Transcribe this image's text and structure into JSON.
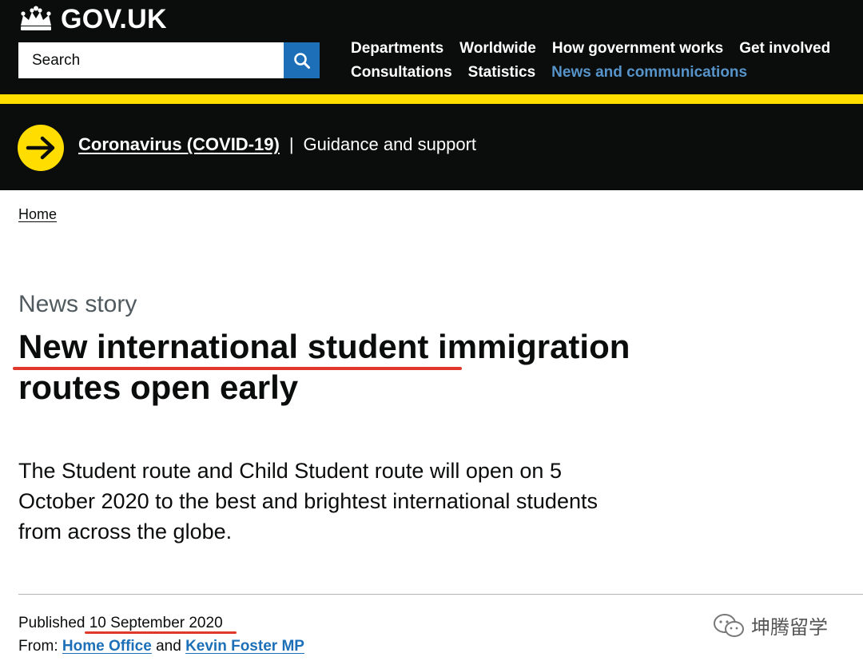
{
  "header": {
    "logo_text": "GOV.UK",
    "search": {
      "placeholder": "Search"
    },
    "nav_row1": [
      "Departments",
      "Worldwide",
      "How government works",
      "Get involved"
    ],
    "nav_row2": [
      "Consultations",
      "Statistics",
      "News and communications"
    ],
    "active_nav": "News and communications",
    "accent_color": "#ffdd00",
    "link_blue": "#1d70b8"
  },
  "banner": {
    "link": "Coronavirus (COVID-19)",
    "separator": "|",
    "text": "Guidance and support"
  },
  "breadcrumb": {
    "home": "Home"
  },
  "article": {
    "caption": "News story",
    "title": "New international student immigration routes open early",
    "lead": "The Student route and Child Student route will open on 5 October 2020 to the best and brightest international students from across the globe.",
    "published_label": "Published",
    "published_date": "10 September 2020",
    "from_label": "From:",
    "from_org": "Home Office",
    "and_text": "and",
    "from_person": "Kevin Foster MP"
  },
  "watermark": {
    "text": "坤腾留学"
  }
}
